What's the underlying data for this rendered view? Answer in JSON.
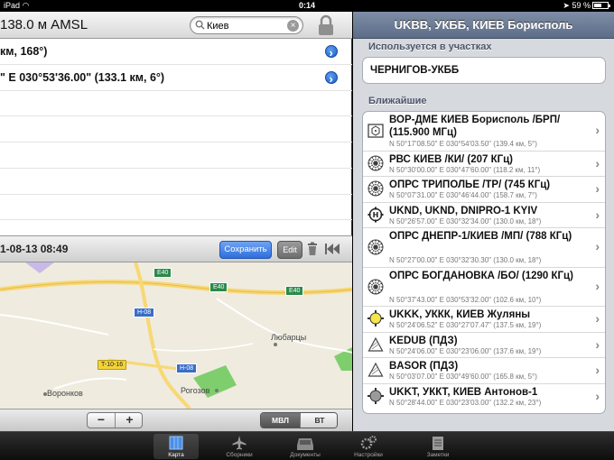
{
  "status": {
    "carrier": "iPad",
    "time": "0:14",
    "battery": "59 %",
    "battery_level": 0.59
  },
  "left": {
    "altitude": "138.0 м AMSL",
    "search": {
      "value": "Киев",
      "placeholder": ""
    },
    "rows": [
      {
        "text": "км, 168°)",
        "disclosure": true
      },
      {
        "text": "\" E 030°53'36.00\" (133.1 км, 6°)",
        "disclosure": true
      },
      {
        "text": "",
        "disclosure": false
      },
      {
        "text": "",
        "disclosure": false
      },
      {
        "text": "",
        "disclosure": false
      },
      {
        "text": "",
        "disclosure": false
      },
      {
        "text": "",
        "disclosure": false
      }
    ],
    "datetime": "1-08-13 08:49",
    "save_label": "Сохранить",
    "edit_label": "Edit",
    "map": {
      "places": [
        "Любарцы",
        "Воронков",
        "Рогозов"
      ],
      "roads": [
        "E40",
        "E40",
        "E40",
        "H-08",
        "H-08",
        "T-10-16"
      ]
    },
    "zoom": {
      "minus": "−",
      "plus": "+"
    },
    "map_type": {
      "mvl": "МВЛ",
      "vt": "ВТ"
    }
  },
  "right": {
    "title": "UKBB, УКББ, КИЕВ Борисполь",
    "used_header": "Используется в участках",
    "used_item": "ЧЕРНИГОВ-УКББ",
    "nearby_header": "Ближайшие",
    "nearby": [
      {
        "icon": "vor-dme-icon",
        "name": "ВОР-ДМЕ КИЕВ Борисполь /БРП/ (115.900 МГц)",
        "coord": "N 50°17'08.50\" E 030°54'03.50\" (139.4 км, 5°)"
      },
      {
        "icon": "ndb-icon",
        "name": "РВС КИЕВ /КИ/ (207 КГц)",
        "coord": "N 50°30'00.00\" E 030°47'60.00\" (118.2 км, 11°)"
      },
      {
        "icon": "ndb-icon",
        "name": "ОПРС ТРИПОЛЬЕ /ТР/ (745 КГц)",
        "coord": "N 50°07'31.00\" E 030°46'44.00\" (158.7 км, 7°)"
      },
      {
        "icon": "heliport-icon",
        "name": "UKND, UKND, DNIPRO-1 KYIV",
        "coord": "N 50°26'57.00\" E 030°32'34.00\" (130.0 км, 18°)"
      },
      {
        "icon": "ndb-icon",
        "name": "ОПРС ДНЕПР-1/КИЕВ /МП/ (788 КГц)",
        "coord": "N 50°27'00.00\" E 030°32'30.30\" (130.0 км, 18°)"
      },
      {
        "icon": "ndb-icon",
        "name": "ОПРС БОГДАНОВКА /БО/ (1290 КГц)",
        "coord": "N 50°37'43.00\" E 030°53'32.00\" (102.6 км, 10°)"
      },
      {
        "icon": "airport-yellow-icon",
        "name": "UKKK, УККК, КИЕВ Жуляны",
        "coord": "N 50°24'06.52\" E 030°27'07.47\" (137.5 км, 19°)"
      },
      {
        "icon": "waypoint-triangle-icon",
        "name": "KEDUB (ПДЗ)",
        "coord": "N 50°24'06.00\" E 030°23'06.00\" (137.6 км, 19°)"
      },
      {
        "icon": "waypoint-triangle-icon",
        "name": "BASOR (ПДЗ)",
        "coord": "N 50°03'07.00\" E 030°49'60.00\" (165.8 км, 5°)"
      },
      {
        "icon": "airport-grey-icon",
        "name": "UKKT, УККТ, КИЕВ Антонов-1",
        "coord": "N 50°28'44.00\" E 030°23'03.00\" (132.2 км, 23°)"
      }
    ]
  },
  "tabs": [
    {
      "label": "Карта",
      "icon": "map-icon",
      "active": true
    },
    {
      "label": "Сборники",
      "icon": "airplane-icon",
      "active": false
    },
    {
      "label": "Документы",
      "icon": "inbox-icon",
      "active": false
    },
    {
      "label": "Настройки",
      "icon": "gears-icon",
      "active": false
    },
    {
      "label": "Заметки",
      "icon": "notepad-icon",
      "active": false
    }
  ]
}
